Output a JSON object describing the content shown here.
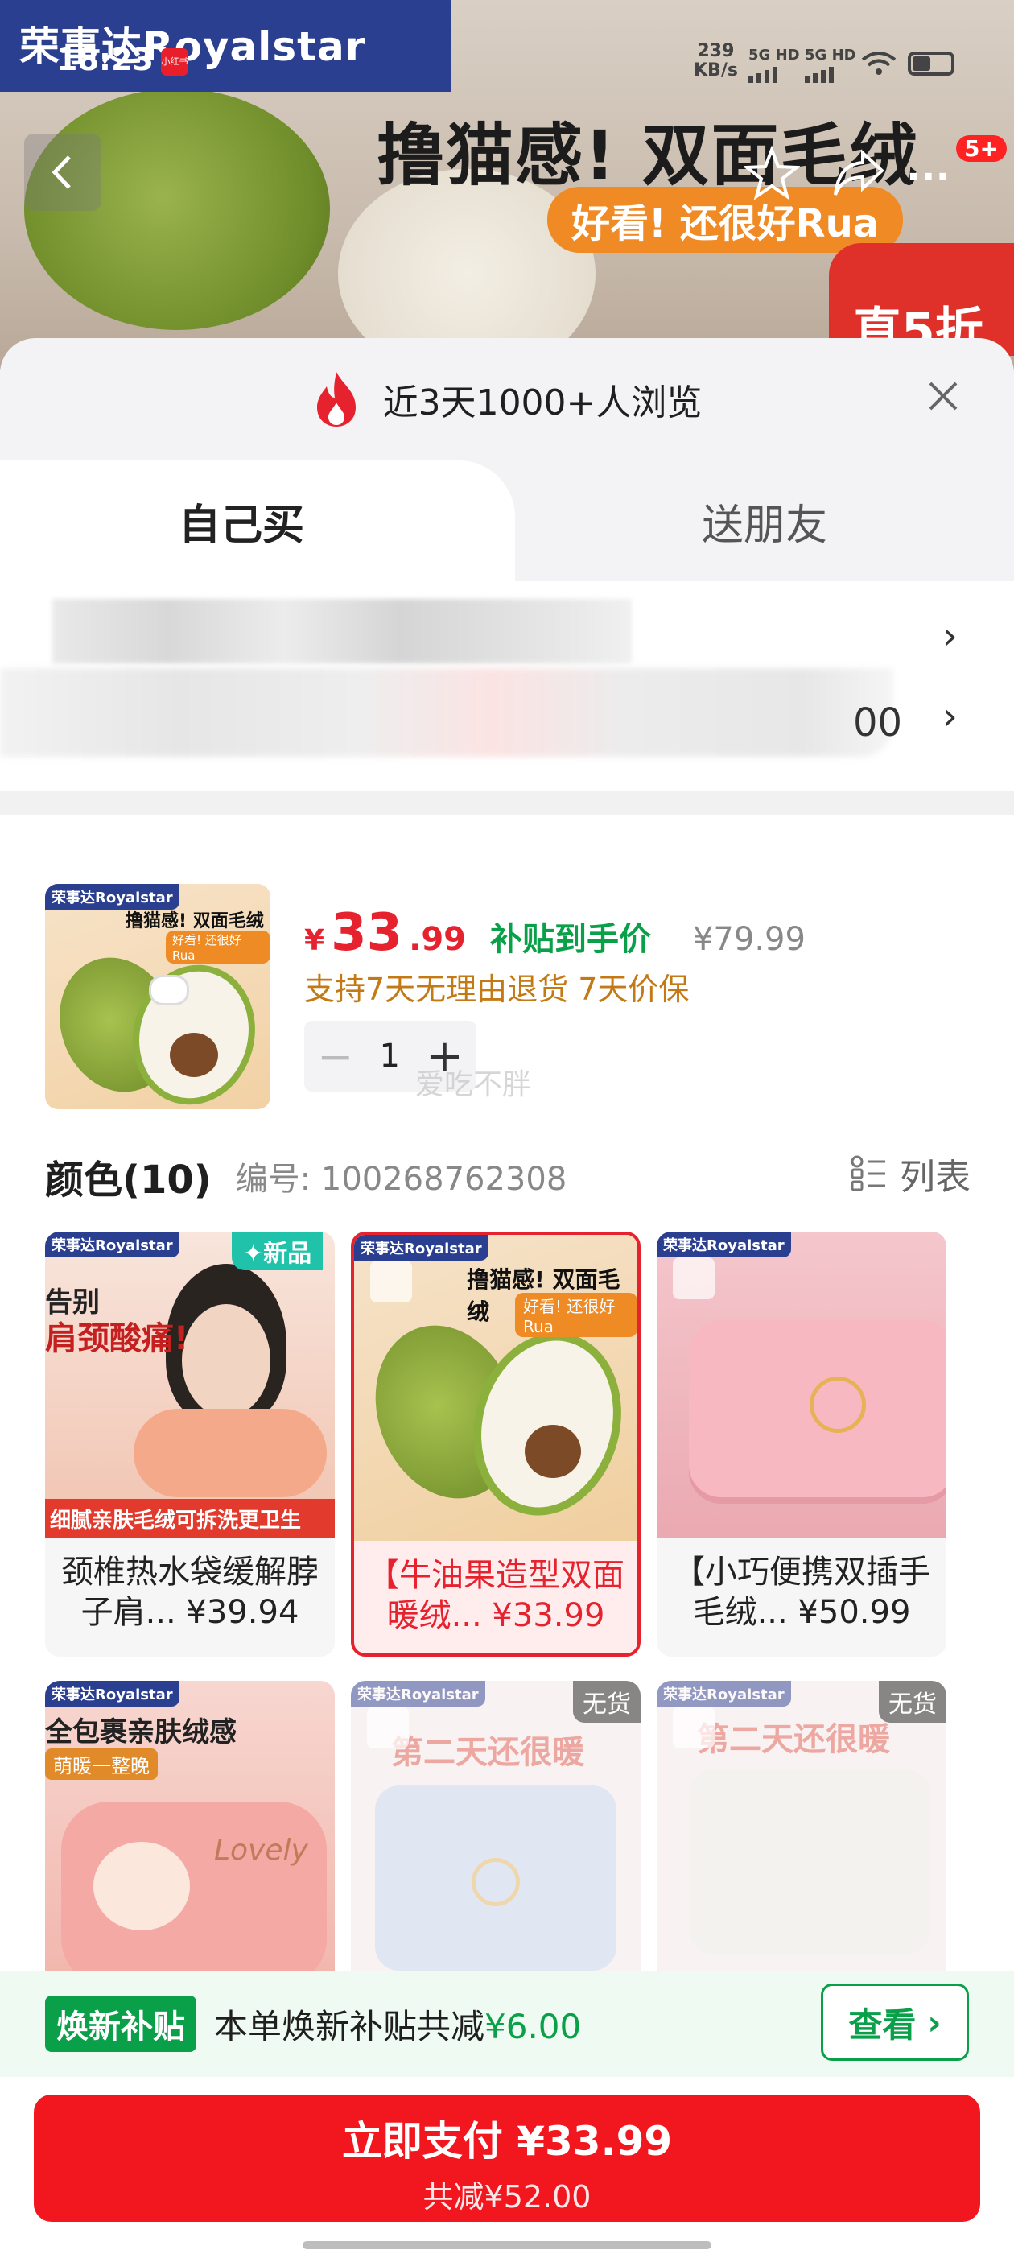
{
  "banner": {
    "brand": "荣事达Royalstar",
    "headline": "撸猫感! 双面毛绒",
    "subline": "好看! 还很好Rua",
    "discount": "直5折",
    "badge_count": "5+"
  },
  "status": {
    "time": "18:23",
    "net_speed_value": "239",
    "net_speed_unit": "KB/s",
    "sim1": "5G HD",
    "sim2": "5G HD"
  },
  "sheet": {
    "views_text": "近3天1000+人浏览",
    "tabs": [
      "自己买",
      "送朋友"
    ],
    "address_trailing": "00"
  },
  "product": {
    "price_currency": "¥",
    "price_int": "33",
    "price_dec": ".99",
    "subsidy_label": "补贴到手价",
    "original_price": "¥79.99",
    "policy": "支持7天无理由退货  7天价保",
    "quantity": "1",
    "watermark": "爱吃不胖",
    "thumb_headline": "撸猫感! 双面毛绒",
    "thumb_subline": "好看! 还很好Rua",
    "brand": "荣事达Royalstar"
  },
  "colors": {
    "title": "颜色(10)",
    "code": "编号: 100268762308",
    "list_label": "列表",
    "new_label": "✦新品",
    "oos_label": "无货",
    "items": [
      {
        "line1": "颈椎热水袋缓解脖",
        "line2": "子肩... ¥39.94",
        "banner_top": "告别",
        "banner_big": "肩颈酸痛!",
        "banner_foot": "细腻亲肤毛绒可拆洗更卫生"
      },
      {
        "line1": "【牛油果造型双面",
        "line2": "暖绒... ¥33.99"
      },
      {
        "line1": "【小巧便携双插手",
        "line2": "毛绒... ¥50.99"
      },
      {
        "banner_top": "全包裹亲肤绒感",
        "banner_sub": "萌暖一整晚",
        "script": "Lovely"
      },
      {
        "banner_top": "第二天还很暖"
      },
      {
        "banner_top": "第二天还很暖"
      }
    ]
  },
  "subsidy": {
    "tag": "焕新补贴",
    "text": "本单焕新补贴共减",
    "amount": "¥6.00",
    "view_label": "查看"
  },
  "pay": {
    "main": "立即支付 ¥33.99",
    "sub": "共减¥52.00"
  },
  "colors_palette": {
    "accent_red": "#e6222e",
    "green": "#0aa04a",
    "brand_blue": "#2b3f91"
  }
}
